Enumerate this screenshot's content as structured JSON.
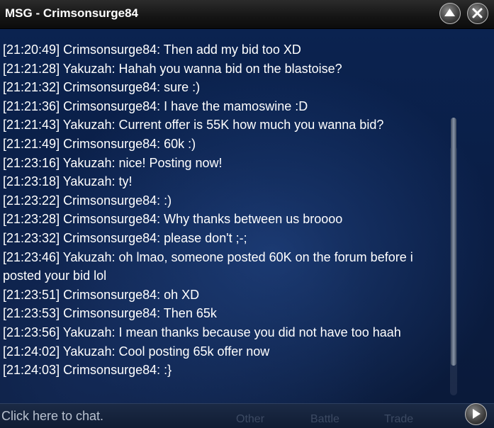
{
  "window": {
    "title": "MSG - Crimsonsurge84",
    "icons": {
      "scroll_up": "chevron-up-icon",
      "close": "close-icon",
      "send": "play-icon"
    }
  },
  "messages": [
    "[21:20:49] Crimsonsurge84: Then add my bid too XD",
    "[21:21:28] Yakuzah: Hahah you wanna bid on the blastoise?",
    "[21:21:32] Crimsonsurge84: sure :)",
    "[21:21:36] Crimsonsurge84: I have the mamoswine :D",
    "[21:21:43] Yakuzah: Current offer is 55K how much you wanna bid?",
    "[21:21:49] Crimsonsurge84: 60k :)",
    "[21:23:16] Yakuzah: nice! Posting now!",
    "[21:23:18] Yakuzah: ty!",
    "[21:23:22] Crimsonsurge84: :)",
    "[21:23:28] Crimsonsurge84: Why thanks between us broooo",
    "[21:23:32] Crimsonsurge84: please don't ;-;",
    "[21:23:46] Yakuzah: oh lmao, someone posted 60K on the forum before i posted your bid lol",
    "[21:23:51] Crimsonsurge84: oh XD",
    "[21:23:53] Crimsonsurge84: Then 65k",
    "[21:23:56] Yakuzah: I mean thanks because you did not have too haah",
    "[21:24:02] Yakuzah: Cool posting 65k offer now",
    "[21:24:03] Crimsonsurge84: :}"
  ],
  "input": {
    "placeholder": "Click here to chat.",
    "value": ""
  },
  "tabs": [
    "Other",
    "Battle",
    "Trade"
  ],
  "colors": {
    "text": "#ffffff",
    "chat_background": "#0a1d44",
    "titlebar": "#151515"
  }
}
